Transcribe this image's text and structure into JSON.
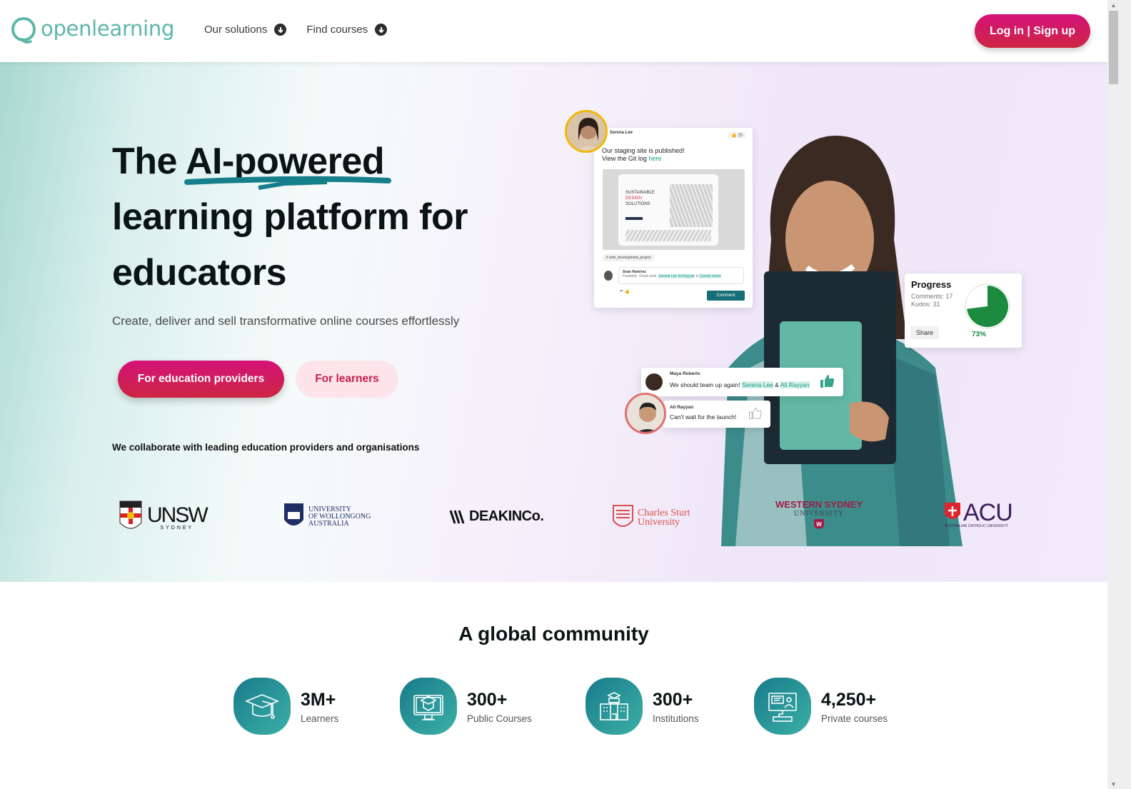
{
  "header": {
    "logo_text": "openlearning",
    "nav": [
      {
        "label": "Our solutions",
        "icon": "arrow-down-circle-icon"
      },
      {
        "label": "Find courses",
        "icon": "arrow-down-circle-icon"
      }
    ],
    "login_label": "Log in | Sign up"
  },
  "hero": {
    "title_line1_pre": "The ",
    "title_highlight": "AI-powered",
    "title_line2": "learning platform for",
    "title_line3": "educators",
    "subtitle": "Create, deliver and sell transformative online courses effortlessly",
    "primary_button": "For education providers",
    "secondary_button": "For learners",
    "collab_text": "We collaborate with leading education providers and organisations"
  },
  "partners": [
    {
      "name": "UNSW",
      "sub": "SYDNEY"
    },
    {
      "name": "UNIVERSITY OF WOLLONGONG AUSTRALIA",
      "lines": [
        "UNIVERSITY",
        "OF WOLLONGONG",
        "AUSTRALIA"
      ]
    },
    {
      "name": "DEAKINCo."
    },
    {
      "name": "Charles Sturt University",
      "lines": [
        "Charles Sturt",
        "University"
      ]
    },
    {
      "name": "WESTERN SYDNEY UNIVERSITY",
      "lines": [
        "WESTERN SYDNEY",
        "UNIVERSITY"
      ]
    },
    {
      "name": "ACU",
      "sub": "AUSTRALIAN CATHOLIC UNIVERSITY"
    }
  ],
  "mockup": {
    "post": {
      "author": "Serena Lee",
      "likes": "15",
      "message_line1": "Our staging site is published!",
      "message_line2_pre": "View the Git log ",
      "message_link": "here",
      "image_heading": [
        "SUSTAINABLE",
        "DESIGN",
        "SOLUTIONS"
      ],
      "tag": "# web_development_project",
      "commenter": "Sean Ramirez",
      "comment_pre": "Fantastic. Great work, ",
      "comment_mentions": [
        "Serena Lee",
        "Ali Rayyan",
        "Crystal Jones"
      ],
      "comment_button": "Comment"
    },
    "progress": {
      "title": "Progress",
      "comments": "Comments: 17",
      "kudos": "Kudos: 31",
      "share_label": "Share",
      "percent_label": "73%",
      "percent_value": 0.73,
      "color": "#1c8a3f"
    },
    "chats": [
      {
        "name": "Maya Roberts",
        "text_pre": "We should team up again! ",
        "mentions": [
          "Serena Lee",
          "Ali Rayyan"
        ],
        "liked": true
      },
      {
        "name": "Ali Rayyan",
        "text": "Can't wait for the launch!",
        "liked": false
      }
    ]
  },
  "community": {
    "title": "A global community",
    "stats": [
      {
        "value": "3M+",
        "label": "Learners",
        "icon": "graduation-cap-icon"
      },
      {
        "value": "300+",
        "label": "Public Courses",
        "icon": "monitor-course-icon"
      },
      {
        "value": "300+",
        "label": "Institutions",
        "icon": "institution-building-icon"
      },
      {
        "value": "4,250+",
        "label": "Private courses",
        "icon": "private-course-computer-icon"
      }
    ]
  },
  "colors": {
    "brand_teal": "#5cb8a8",
    "primary_pink": "#d4127a",
    "secondary_bg": "#fde4ea"
  }
}
